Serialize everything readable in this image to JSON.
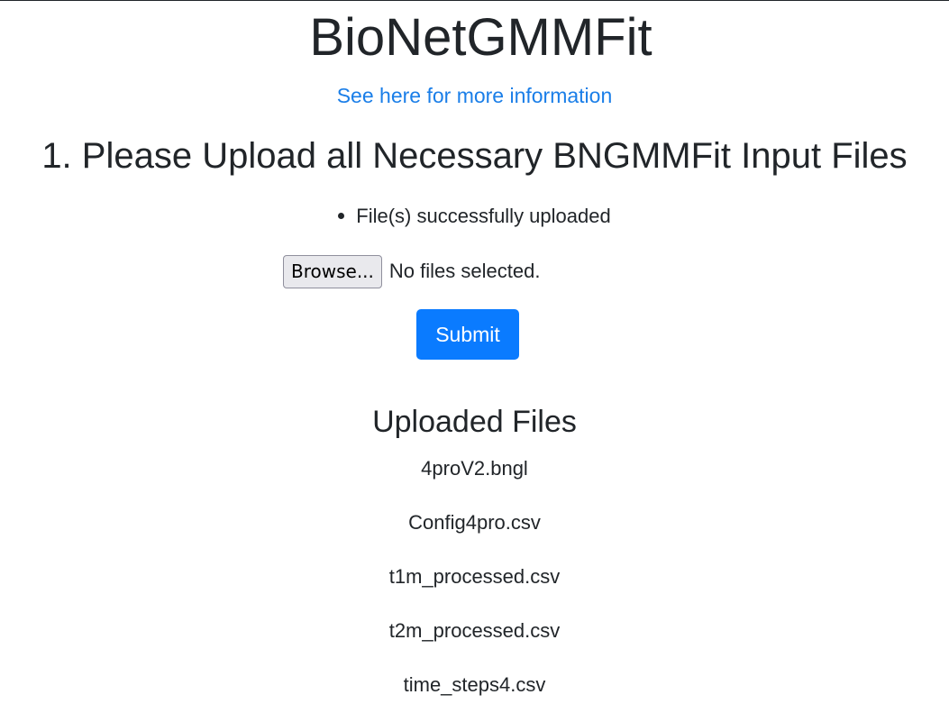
{
  "header": {
    "title": "BioNetGMMFit",
    "info_link": "See here for more information"
  },
  "upload_section": {
    "heading": "1. Please Upload all Necessary BNGMMFit Input Files",
    "messages": [
      "File(s) successfully uploaded"
    ],
    "browse_label": "Browse...",
    "file_status": "No files selected.",
    "submit_label": "Submit"
  },
  "uploaded_files": {
    "heading": "Uploaded Files",
    "files": [
      "4proV2.bngl",
      "Config4pro.csv",
      "t1m_processed.csv",
      "t2m_processed.csv",
      "time_steps4.csv"
    ]
  },
  "colors": {
    "link": "#1a7ee8",
    "primary_button": "#0a7bff",
    "text": "#212529"
  }
}
